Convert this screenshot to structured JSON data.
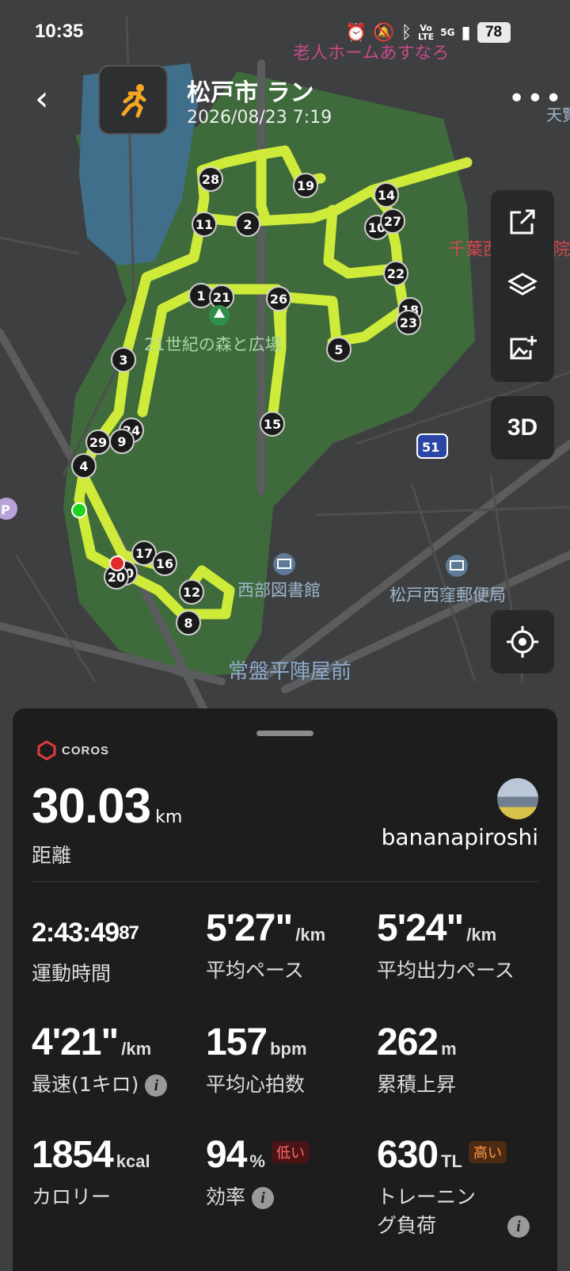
{
  "status_bar": {
    "time": "10:35",
    "volte_line1": "Vo",
    "volte_line2": "LTE",
    "network": "5G",
    "battery": "78"
  },
  "header": {
    "title": "松戸市 ラン",
    "datetime": "2026/08/23 7:19",
    "back_icon": "chevron-left-icon",
    "activity_icon": "running-person-icon",
    "more_icon": "more-dots-icon"
  },
  "map": {
    "labels": {
      "nursing_home": "老人ホームあすなろ",
      "hospital": "千葉西総合病院",
      "park": "21世紀の森と広場",
      "library": "西部図書館",
      "post_office": "松戸西窪郵便局",
      "station": "常盤平陣屋前",
      "road_number": "51",
      "edge_top_right": "天覧",
      "parking": "P"
    },
    "markers": [
      "28",
      "19",
      "14",
      "11",
      "2",
      "10",
      "27",
      "22",
      "1",
      "21",
      "26",
      "18",
      "23",
      "5",
      "3",
      "15",
      "24",
      "29",
      "9",
      "4",
      "17",
      "16",
      "30",
      "20",
      "12",
      "8"
    ],
    "accent_route": "#d7f23a",
    "start_color": "#1fd21f",
    "end_color": "#e22c2c"
  },
  "toolbar": {
    "share_icon": "share-icon",
    "layers_icon": "layers-icon",
    "add_photo_icon": "add-photo-icon",
    "view_3d_label": "3D",
    "locate_icon": "locate-icon"
  },
  "summary": {
    "brand": "COROS",
    "distance": "30.03",
    "distance_unit": "km",
    "distance_label": "距離",
    "username": "bananapiroshi",
    "stats": {
      "time": {
        "value": "2:43:49",
        "fraction": "87",
        "label": "運動時間"
      },
      "avg_pace": {
        "value": "5'27\"",
        "unit": "/km",
        "label": "平均ペース"
      },
      "avg_power_pace": {
        "value": "5'24\"",
        "unit": "/km",
        "label": "平均出力ペース"
      },
      "best_km": {
        "value": "4'21\"",
        "unit": "/km",
        "label": "最速(1キロ)"
      },
      "avg_hr": {
        "value": "157",
        "unit": "bpm",
        "label": "平均心拍数"
      },
      "elevation": {
        "value": "262",
        "unit": "m",
        "label": "累積上昇"
      },
      "calories": {
        "value": "1854",
        "unit": "kcal",
        "label": "カロリー"
      },
      "efficiency": {
        "value": "94",
        "unit": "%",
        "badge": "低い",
        "label": "効率"
      },
      "training_load": {
        "value": "630",
        "unit": "TL",
        "badge": "高い",
        "label_line1": "トレーニン",
        "label_line2": "グ負荷"
      }
    }
  }
}
